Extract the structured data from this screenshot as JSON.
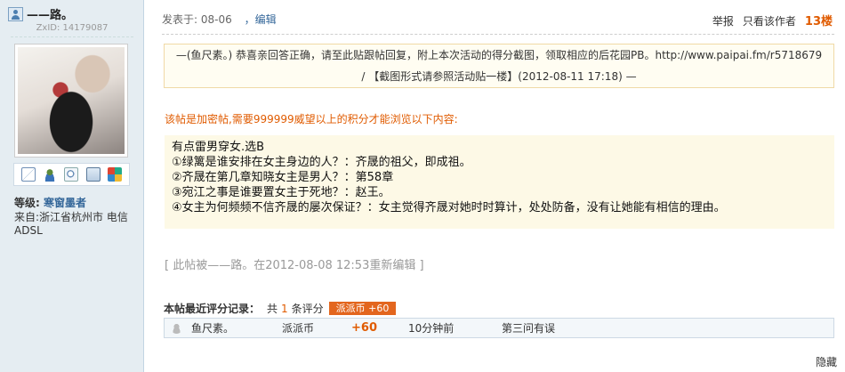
{
  "author": {
    "name": "——路。",
    "uid": "ZxID:  14179087",
    "level_label": "等级:",
    "level_value": "寒窗墨者",
    "location": "来自:浙江省杭州市 电信ADSL"
  },
  "post": {
    "posted": "发表于: 08-06",
    "edit_label": "，编辑",
    "report_label": "举报",
    "only_author_label": "只看该作者",
    "floor": "13楼",
    "notice_line1": "—(鱼尺素。) 恭喜亲回答正确，请至此贴跟帖回复，附上本次活动的得分截图，领取相应的后花园PB。http://www.paipai.fm/r5718679",
    "notice_line2": "/ 【截图形式请参照活动贴一楼】(2012-08-11 17:18) —",
    "locked_text": "该帖是加密帖,需要999999威望以上的积分才能浏览以下内容:",
    "quote_lines": [
      "有点雷男穿女.选B",
      "①绿篱是谁安排在女主身边的人？：齐晟的祖父，即成祖。",
      "②齐晟在第几章知晓女主是男人？：第58章",
      "③宛江之事是谁要置女主于死地？：赵王。",
      "④女主为何频频不信齐晟的屡次保证？：女主觉得齐晟对她时时算计，处处防备，没有让她能有相信的理由。"
    ],
    "rewrite_note": "[ 此帖被——路。在2012-08-08 12:53重新编辑 ]"
  },
  "rating": {
    "title": "本帖最近评分记录：",
    "count_prefix": "共",
    "count": "1",
    "count_suffix": "条评分",
    "badge": "派派币 +60",
    "rows": [
      {
        "user": "鱼尺素。",
        "currency": "派派币",
        "amount": "+60",
        "time": "10分钟前",
        "reason": "第三问有误"
      }
    ],
    "hide_label": "隐藏"
  }
}
